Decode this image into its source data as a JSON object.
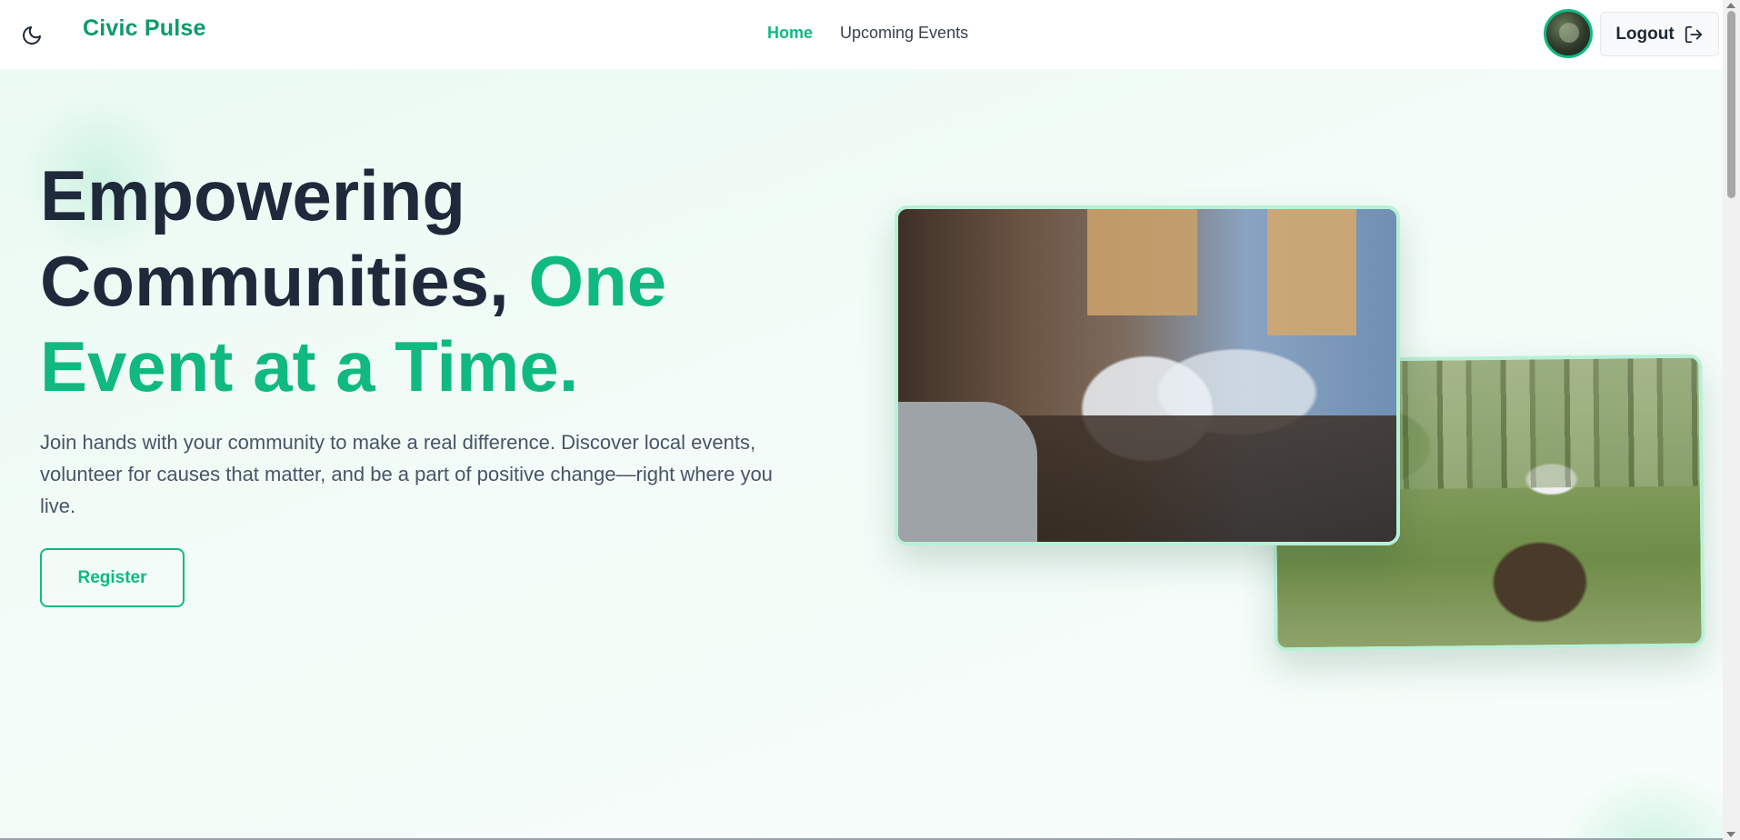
{
  "nav": {
    "brand": "Civic Pulse",
    "theme_toggle_icon": "moon-icon",
    "links": [
      {
        "label": "Home",
        "active": true
      },
      {
        "label": "Upcoming Events",
        "active": false
      }
    ],
    "logout_label": "Logout",
    "logout_icon": "logout-icon",
    "avatar_icon": "user-avatar"
  },
  "hero": {
    "headline_part1": "Empowering Communities, ",
    "headline_accent": "One Event at a Time.",
    "subtext": "Join hands with your community to make a real difference. Discover local events, volunteer for causes that matter, and be a part of positive change—right where you live.",
    "register_label": "Register"
  },
  "colors": {
    "accent": "#10b981",
    "brand": "#0e9a6a",
    "heading": "#1e293b",
    "body_text": "#475569"
  }
}
